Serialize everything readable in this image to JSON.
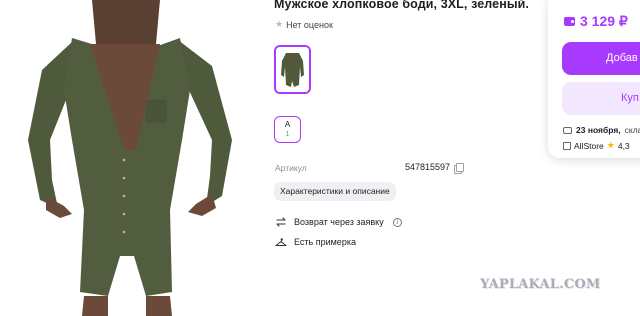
{
  "product": {
    "title": "Мужское хлопковое боди, 3XL, зеленый.",
    "rating_text": "Нет оценок",
    "size": {
      "label": "A",
      "count": "1"
    },
    "article_label": "Артикул",
    "article_value": "547815597",
    "characteristics_chip": "Характеристики и описание",
    "features": {
      "return_label": "Возврат через заявку",
      "fitting_label": "Есть примерка"
    }
  },
  "purchase": {
    "price": "3 129 ₽",
    "add_button_label": "Добав",
    "buy_button_label": "Куп",
    "delivery_date": "23 ноября,",
    "delivery_rest": " скла",
    "store_name": "AllStore",
    "store_rating": "4,3"
  },
  "watermark": "YAPLAKAL.COM",
  "colors": {
    "accent": "#a73afd",
    "accent_light": "#f3e6ff",
    "garment": "#4f5a3c"
  },
  "icons": {
    "star": "star-icon",
    "copy": "copy-icon",
    "return": "return-arrows-icon",
    "fitting": "hanger-icon",
    "wallet": "wallet-icon",
    "info": "info-icon"
  }
}
